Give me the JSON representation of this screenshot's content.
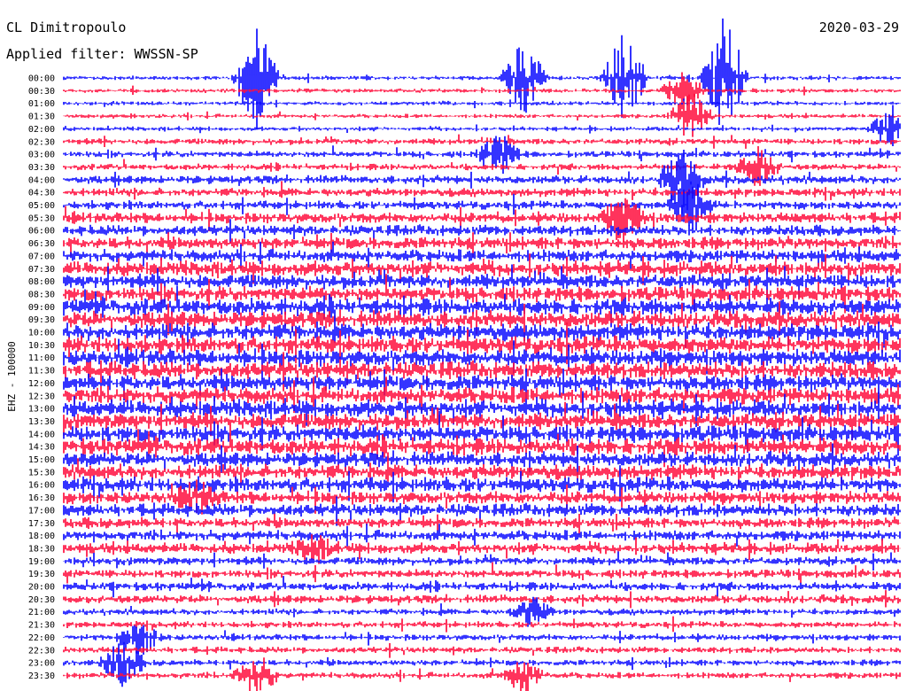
{
  "header": {
    "station": "CL Dimitropoulo",
    "filter": "Applied filter: WWSSN-SP",
    "date": "2020-03-29"
  },
  "chart_data": {
    "type": "line",
    "title": "CL Dimitropoulo",
    "subtitle": "Applied filter: WWSSN-SP",
    "date": "2020-03-29",
    "ylabel": "EHZ - 100000",
    "xlabel": "",
    "row_labels": [
      "00:00",
      "00:30",
      "01:00",
      "01:30",
      "02:00",
      "02:30",
      "03:00",
      "03:30",
      "04:00",
      "04:30",
      "05:00",
      "05:30",
      "06:00",
      "06:30",
      "07:00",
      "07:30",
      "08:00",
      "08:30",
      "09:00",
      "09:30",
      "10:00",
      "10:30",
      "11:00",
      "11:30",
      "12:00",
      "12:30",
      "13:00",
      "13:30",
      "14:00",
      "14:30",
      "15:00",
      "15:30",
      "16:00",
      "16:30",
      "17:00",
      "17:30",
      "18:00",
      "18:30",
      "19:00",
      "19:30",
      "20:00",
      "20:30",
      "21:00",
      "21:30",
      "22:00",
      "22:30",
      "23:00",
      "23:30"
    ],
    "series_colors": [
      "#0000ff",
      "#ff0033"
    ],
    "noise_profile": [
      2,
      2,
      2,
      2,
      2,
      3,
      3,
      3,
      4,
      4,
      4,
      5,
      5,
      6,
      6,
      7,
      7,
      7,
      8,
      8,
      8,
      8,
      8,
      8,
      8,
      8,
      8,
      8,
      8,
      8,
      7,
      7,
      7,
      6,
      6,
      5,
      5,
      5,
      4,
      4,
      4,
      4,
      3,
      3,
      3,
      3,
      3,
      3
    ],
    "events": [
      {
        "row": 0,
        "x": 0.23,
        "amp": 60
      },
      {
        "row": 0,
        "x": 0.79,
        "amp": 70
      },
      {
        "row": 0,
        "x": 0.55,
        "amp": 45
      },
      {
        "row": 0,
        "x": 0.67,
        "amp": 55
      },
      {
        "row": 1,
        "x": 0.74,
        "amp": 22
      },
      {
        "row": 3,
        "x": 0.75,
        "amp": 28
      },
      {
        "row": 4,
        "x": 0.99,
        "amp": 26
      },
      {
        "row": 6,
        "x": 0.52,
        "amp": 24
      },
      {
        "row": 7,
        "x": 0.83,
        "amp": 22
      },
      {
        "row": 8,
        "x": 0.74,
        "amp": 40
      },
      {
        "row": 10,
        "x": 0.75,
        "amp": 32
      },
      {
        "row": 11,
        "x": 0.67,
        "amp": 26
      },
      {
        "row": 33,
        "x": 0.16,
        "amp": 16
      },
      {
        "row": 37,
        "x": 0.3,
        "amp": 14
      },
      {
        "row": 42,
        "x": 0.56,
        "amp": 16
      },
      {
        "row": 44,
        "x": 0.09,
        "amp": 22
      },
      {
        "row": 46,
        "x": 0.07,
        "amp": 26
      },
      {
        "row": 47,
        "x": 0.23,
        "amp": 24
      },
      {
        "row": 47,
        "x": 0.55,
        "amp": 18
      }
    ],
    "grid": false,
    "legend": "none"
  }
}
